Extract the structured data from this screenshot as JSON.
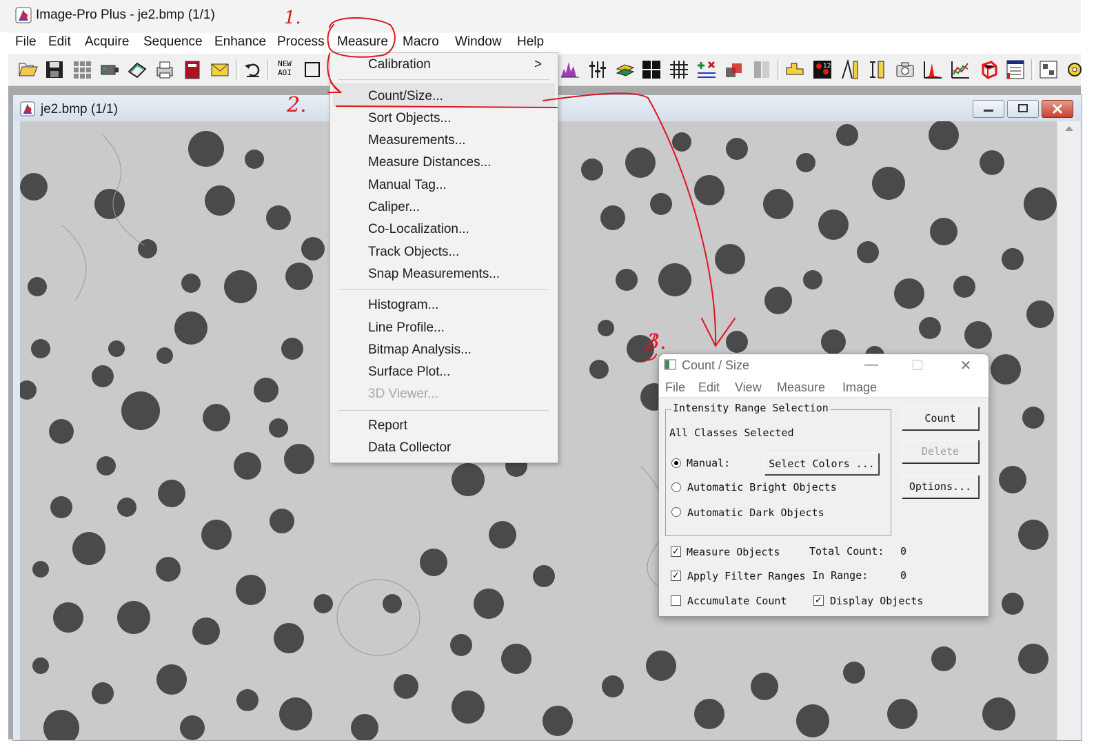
{
  "app": {
    "title": "Image-Pro Plus - je2.bmp (1/1)"
  },
  "menubar": {
    "items": [
      "File",
      "Edit",
      "Acquire",
      "Sequence",
      "Enhance",
      "Process",
      "Measure",
      "Macro",
      "Window",
      "Help"
    ]
  },
  "toolbar": {
    "new_aoi_line1": "NEW",
    "new_aoi_line2": "AOI"
  },
  "image_window": {
    "title": "je2.bmp (1/1)"
  },
  "measure_menu": {
    "items": [
      {
        "label": "Calibration",
        "submenu": true
      },
      {
        "label": "Count/Size..."
      },
      {
        "label": "Sort Objects..."
      },
      {
        "label": "Measurements..."
      },
      {
        "label": "Measure Distances..."
      },
      {
        "label": "Manual Tag..."
      },
      {
        "label": "Caliper..."
      },
      {
        "label": "Co-Localization..."
      },
      {
        "label": "Track Objects..."
      },
      {
        "label": "Snap Measurements..."
      },
      {
        "label": "Histogram..."
      },
      {
        "label": "Line Profile..."
      },
      {
        "label": "Bitmap Analysis..."
      },
      {
        "label": "Surface Plot..."
      },
      {
        "label": "3D Viewer...",
        "disabled": true
      },
      {
        "label": "Report"
      },
      {
        "label": "Data Collector"
      }
    ],
    "submenu_arrow": ">"
  },
  "dialog": {
    "title": "Count / Size",
    "menu": [
      "File",
      "Edit",
      "View",
      "Measure",
      "Image"
    ],
    "group_title": "Intensity Range Selection",
    "classes_text": "All Classes Selected",
    "radio_manual": "Manual:",
    "radio_bright": "Automatic Bright Objects",
    "radio_dark": "Automatic Dark Objects",
    "select_colors_button": "Select Colors ...",
    "count_button": "Count",
    "delete_button": "Delete",
    "options_button": "Options...",
    "measure_objects": "Measure Objects",
    "apply_filter_ranges": "Apply Filter Ranges",
    "accumulate_count": "Accumulate Count",
    "display_objects": "Display Objects",
    "total_count_label": "Total Count:",
    "total_count_value": "0",
    "in_range_label": "In Range:",
    "in_range_value": "0",
    "check_mark": "✓",
    "minimize_glyph": "—",
    "maximize_glyph": "☐",
    "close_glyph": "✕",
    "selected_radio": "manual",
    "checked": {
      "measure_objects": true,
      "apply_filter_ranges": true,
      "accumulate_count": false,
      "display_objects": true
    }
  },
  "annotations": {
    "step1": "1.",
    "step2": "2.",
    "step3": "3.",
    "color": "#e0141e"
  }
}
